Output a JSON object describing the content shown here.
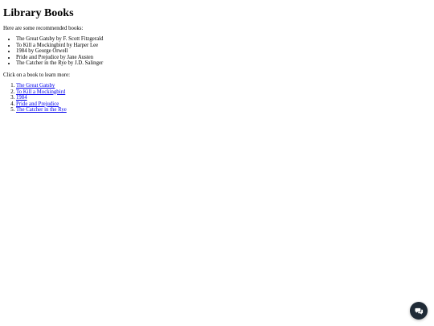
{
  "page": {
    "title": "Library Books",
    "intro": "Here are some recommended books:",
    "recommended": [
      "The Great Gatsby by F. Scott Fitzgerald",
      "To Kill a Mockingbird by Harper Lee",
      "1984 by George Orwell",
      "Pride and Prejudice by Jane Austen",
      "The Catcher in the Rye by J.D. Salinger"
    ],
    "prompt": "Click on a book to learn more:",
    "links": [
      "The Great Gatsby",
      "To Kill a Mockingbird",
      "1984",
      "Pride and Prejudice",
      "The Catcher in the Rye"
    ]
  },
  "chat_widget": {
    "icon": "chat-bubbles-icon",
    "background_color": "#1f2a36"
  }
}
